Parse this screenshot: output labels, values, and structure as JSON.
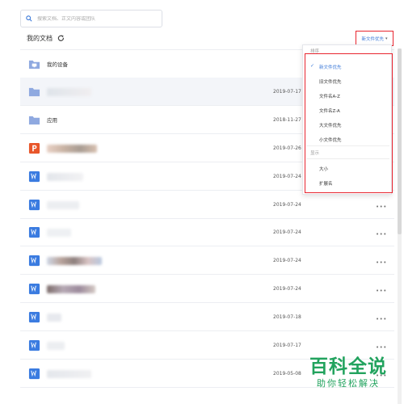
{
  "search": {
    "placeholder": "搜索文档、正文内容或团队",
    "icon": "search-icon"
  },
  "header": {
    "title": "我的文档",
    "refresh_icon": "refresh-icon"
  },
  "sort_button": {
    "label": "新文件优先",
    "caret": "▾"
  },
  "files": [
    {
      "name": "我的设备",
      "date": "",
      "type": "device",
      "blurred": false
    },
    {
      "name": "",
      "date": "2019-07-17",
      "type": "folder",
      "blurred": true
    },
    {
      "name": "应用",
      "date": "2018-11-27",
      "type": "folder",
      "blurred": false
    },
    {
      "name": "",
      "date": "2019-07-26",
      "type": "ppt",
      "blurred": true
    },
    {
      "name": "",
      "date": "2019-07-24",
      "type": "word",
      "blurred": true
    },
    {
      "name": "",
      "date": "2019-07-24",
      "type": "word",
      "blurred": true
    },
    {
      "name": "",
      "date": "2019-07-24",
      "type": "word",
      "blurred": true
    },
    {
      "name": "",
      "date": "2019-07-24",
      "type": "word",
      "blurred": true
    },
    {
      "name": "",
      "date": "2019-07-24",
      "type": "word",
      "blurred": true
    },
    {
      "name": "",
      "date": "2019-07-18",
      "type": "word",
      "blurred": true
    },
    {
      "name": "",
      "date": "2019-07-17",
      "type": "word",
      "blurred": true
    },
    {
      "name": "",
      "date": "2019-05-08",
      "type": "word",
      "blurred": true
    }
  ],
  "more_glyph": "•••",
  "dropdown": {
    "sort_group_label": "排序",
    "sort_options": [
      "新文件优先",
      "旧文件优先",
      "文件名A-Z",
      "文件名Z-A",
      "大文件优先",
      "小文件优先"
    ],
    "selected_index": 0,
    "display_group_label": "显示",
    "display_options": [
      "大小",
      "扩展名"
    ],
    "check_glyph": "✓"
  },
  "watermark": {
    "line1": "百科全说",
    "line2": "助你轻松解决"
  },
  "colors": {
    "accent": "#3a78d8",
    "highlight_frame": "#e8252f",
    "folder": "#8fa9e0",
    "word": "#3a7be0",
    "ppt": "#e8562a",
    "watermark": "#22a35e"
  }
}
